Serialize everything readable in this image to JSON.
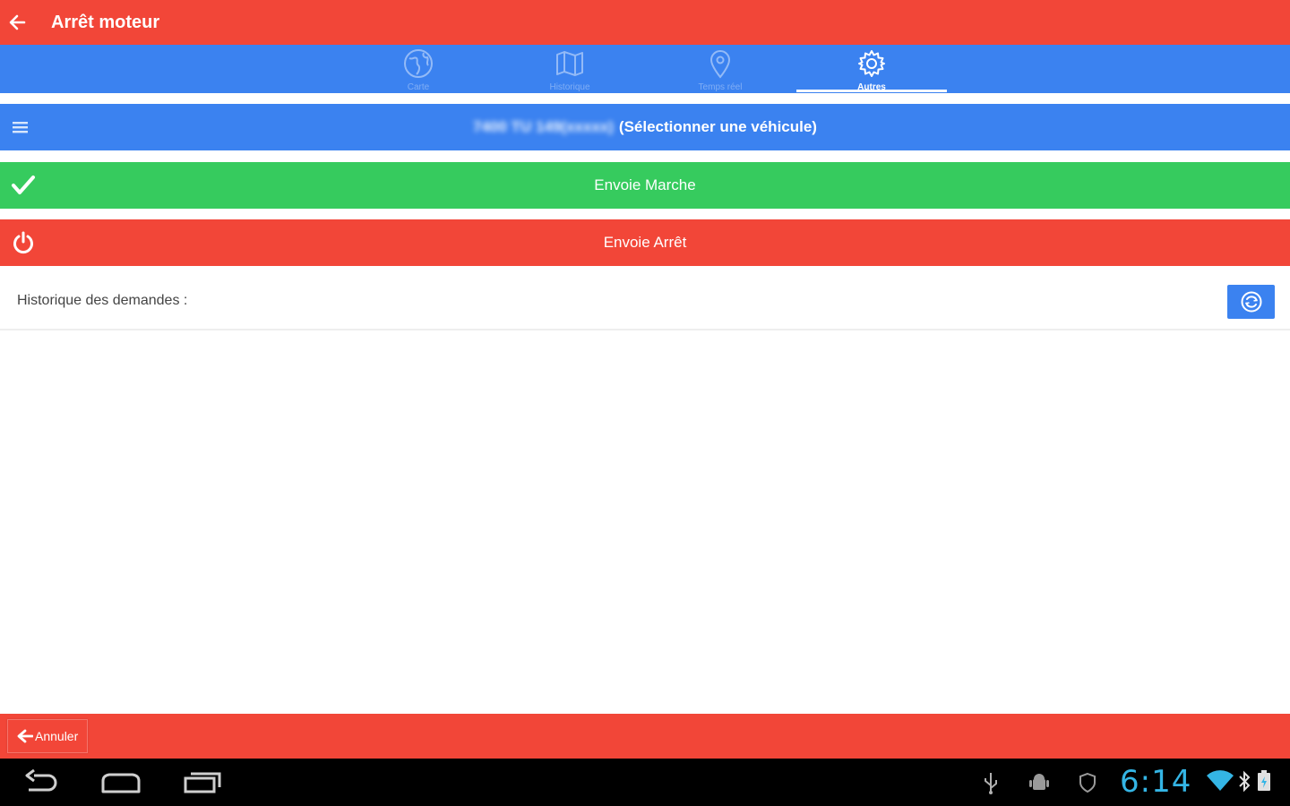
{
  "appbar": {
    "title": "Arrêt moteur"
  },
  "tabs": [
    {
      "label": "Carte",
      "icon": "globe-icon"
    },
    {
      "label": "Historique",
      "icon": "map-icon"
    },
    {
      "label": "Temps réel",
      "icon": "location-pin-icon"
    },
    {
      "label": "Autres",
      "icon": "gear-icon",
      "active": true
    }
  ],
  "vehicle_select": {
    "blurred_text": "7400 TU 149(xxxxx)",
    "label": "(Sélectionner une véhicule)"
  },
  "actions": {
    "march_label": "Envoie Marche",
    "stop_label": "Envoie Arrêt"
  },
  "history": {
    "label": "Historique des demandes :"
  },
  "bottom": {
    "cancel_label": "Annuler"
  },
  "system": {
    "clock": "6:14"
  },
  "colors": {
    "red": "#f24638",
    "blue": "#3b82f0",
    "green": "#36cb5e",
    "clock": "#34b5e5"
  }
}
